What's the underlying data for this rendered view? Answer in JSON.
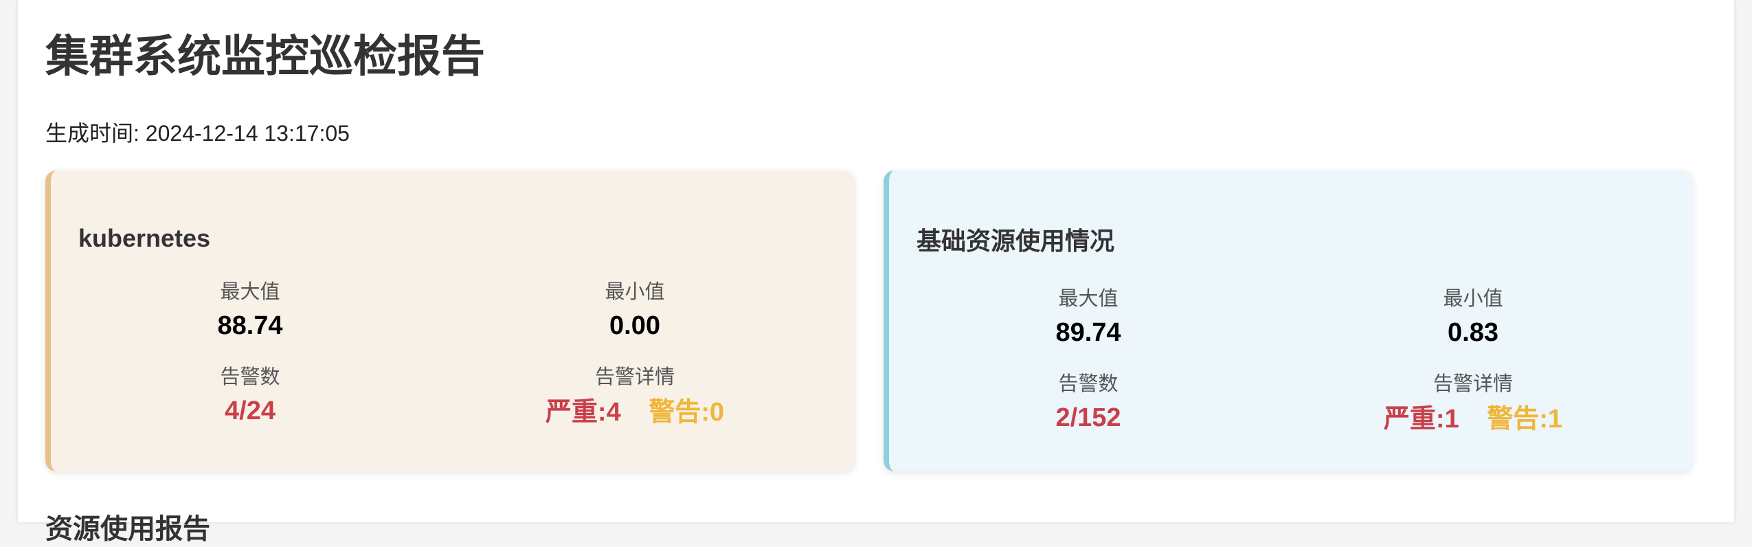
{
  "report": {
    "title": "集群系统监控巡检报告",
    "generated_label": "生成时间:",
    "generated_time": "2024-12-14 13:17:05"
  },
  "cards": {
    "kubernetes": {
      "title": "kubernetes",
      "max_label": "最大值",
      "max_value": "88.74",
      "min_label": "最小值",
      "min_value": "0.00",
      "alert_count_label": "告警数",
      "alert_count_value": "4/24",
      "alert_detail_label": "告警详情",
      "critical": "严重:4",
      "warning": "警告:0"
    },
    "base_resources": {
      "title": "基础资源使用情况",
      "max_label": "最大值",
      "max_value": "89.74",
      "min_label": "最小值",
      "min_value": "0.83",
      "alert_count_label": "告警数",
      "alert_count_value": "2/152",
      "alert_detail_label": "告警详情",
      "critical": "严重:1",
      "warning": "警告:1"
    }
  },
  "next_section": {
    "title": "资源使用报告"
  },
  "colors": {
    "critical": "#c9404a",
    "warning": "#f0b63a",
    "kubernetes_card_bg": "#f8f1e8",
    "kubernetes_card_accent": "#e8c089",
    "base_card_bg": "#ecf6fb",
    "base_card_accent": "#8fcfdc"
  }
}
